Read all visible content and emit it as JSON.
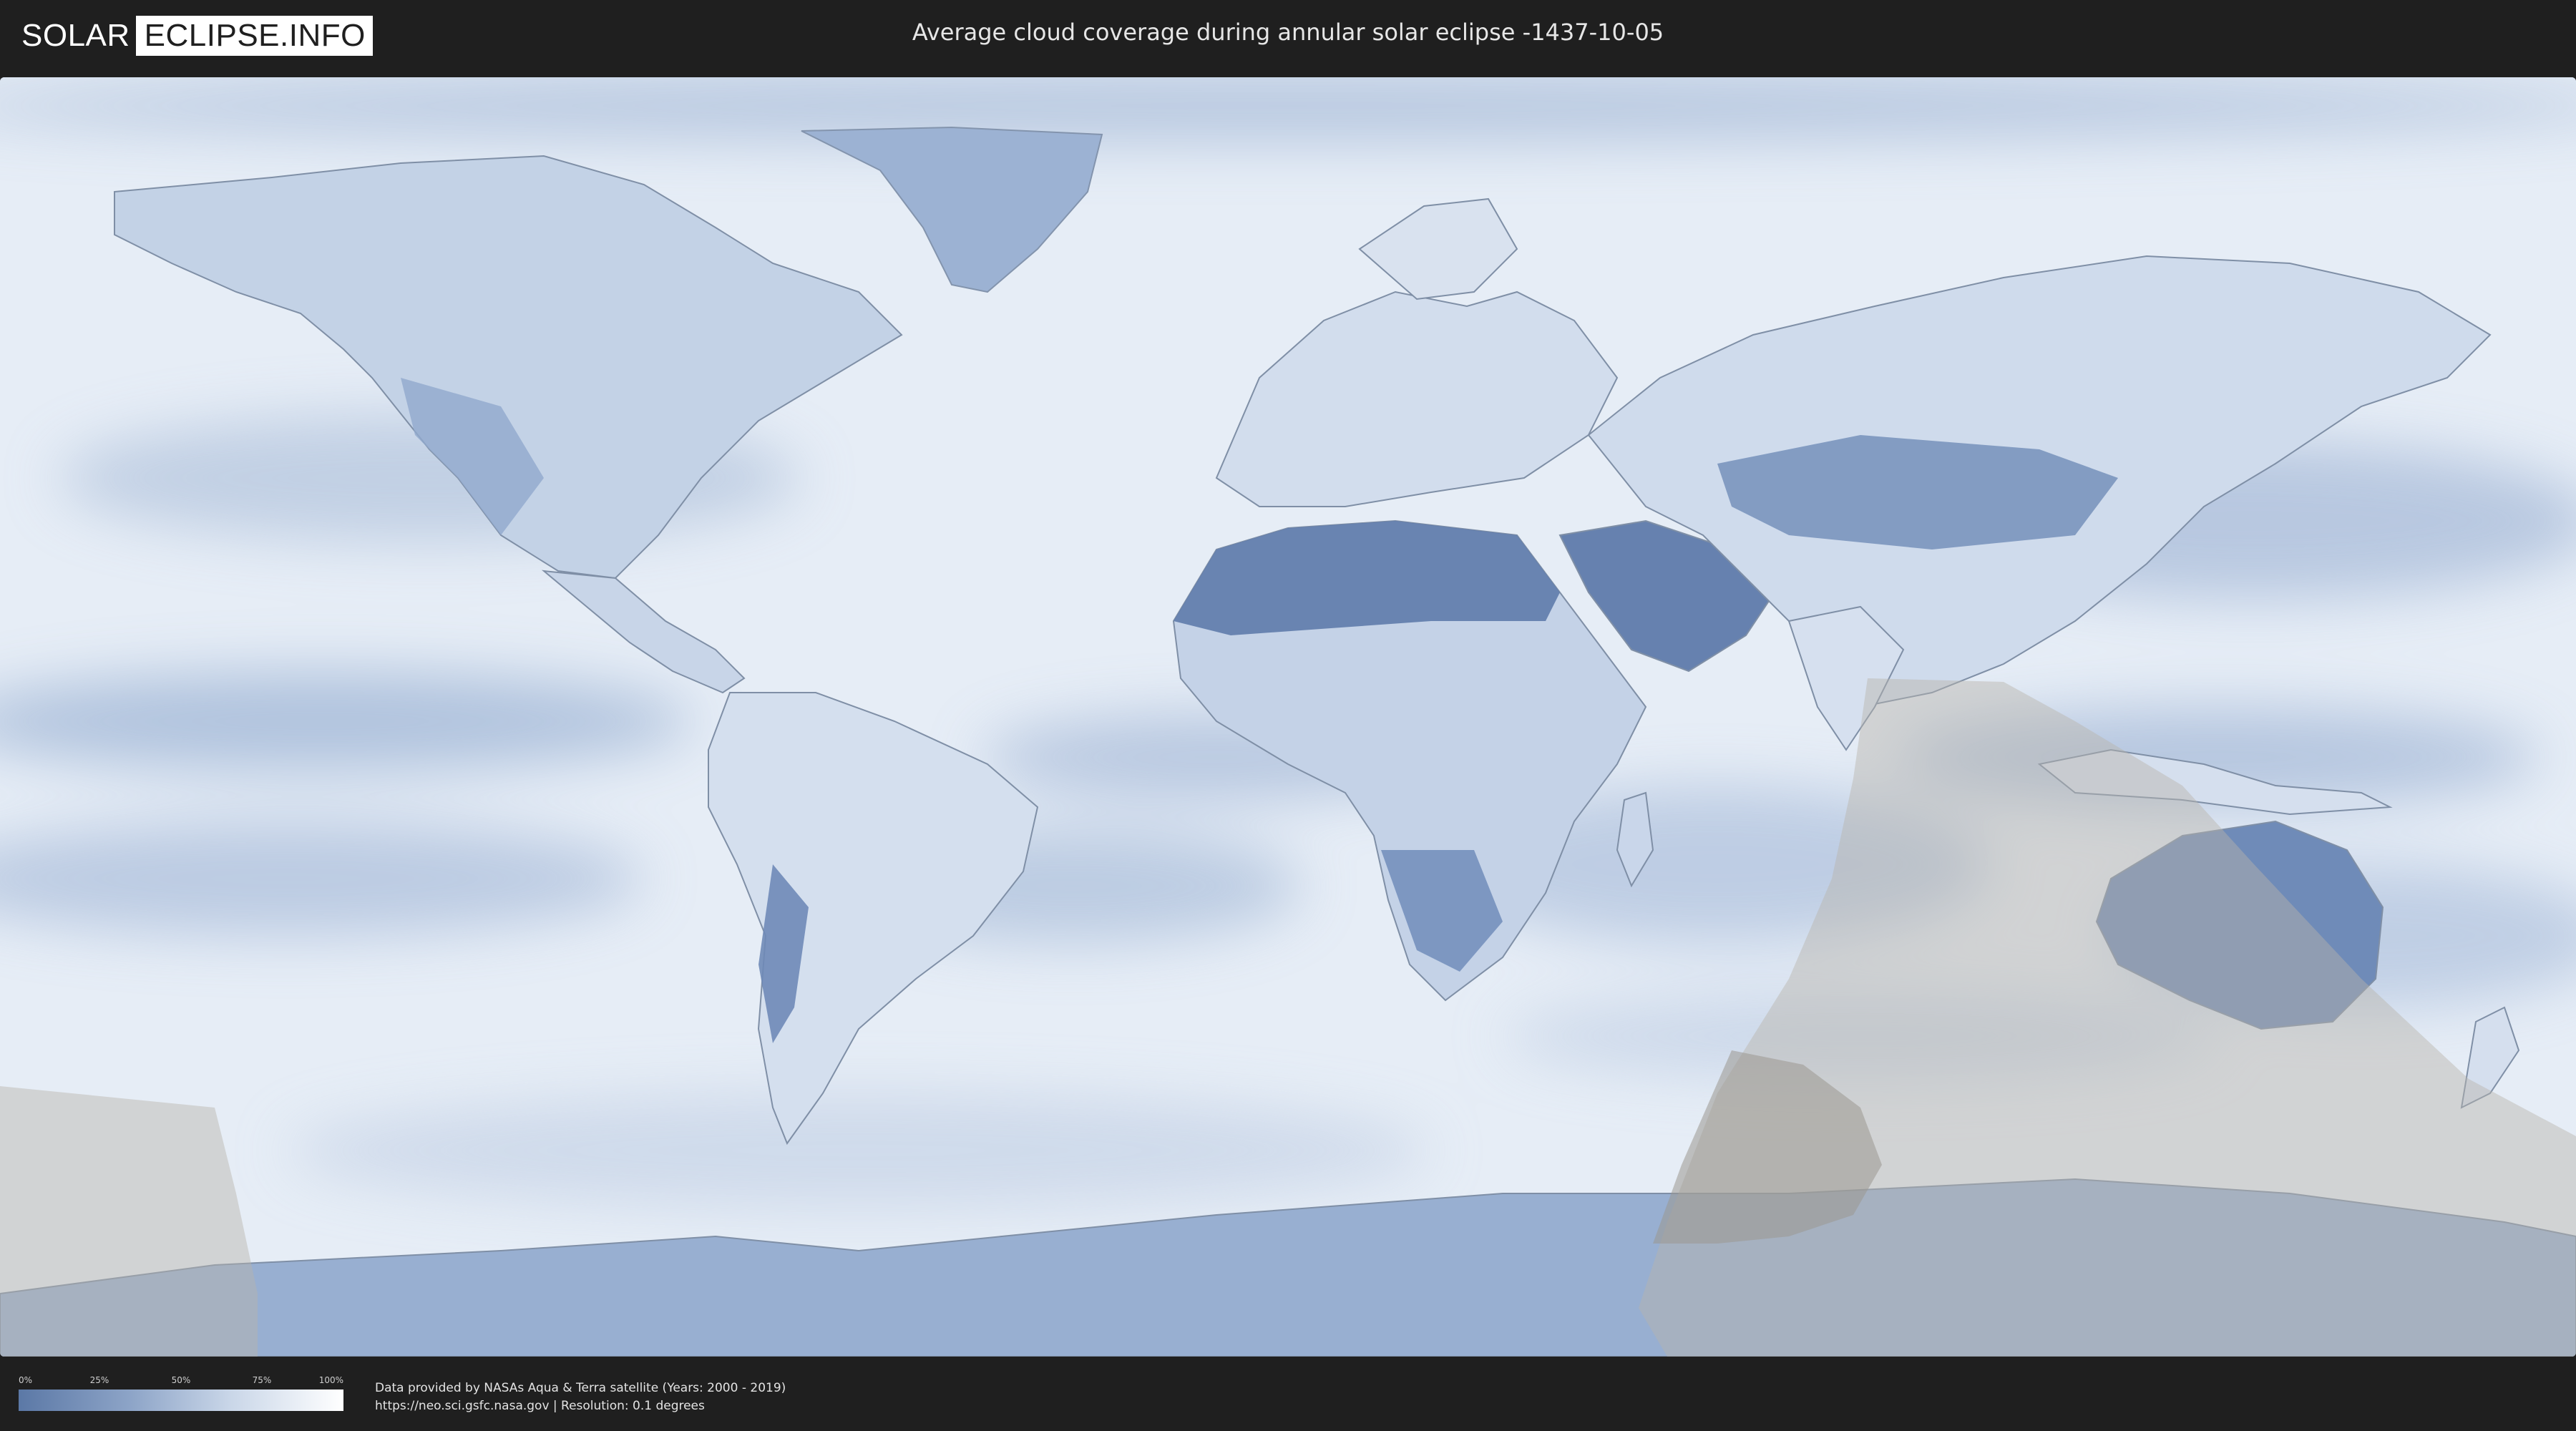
{
  "header": {
    "logo": {
      "part1": "SOLAR",
      "part2": "ECLIPSE.INFO"
    },
    "title": "Average cloud coverage during annular solar eclipse -1437-10-05"
  },
  "map": {
    "palette": {
      "ocean_light": "#eef3f9",
      "cloud_blue": "#8fa9cd",
      "dry_dark": "#6a86b3",
      "land_outline": "#7f8fa6",
      "eclipse_overlay": "#b9b4ab"
    }
  },
  "legend": {
    "ticks": [
      "0%",
      "25%",
      "50%",
      "75%",
      "100%"
    ],
    "gradient": [
      "#5b78a6",
      "#ffffff"
    ]
  },
  "credits": {
    "line1": "Data provided by NASAs Aqua & Terra satellite (Years: 2000 - 2019)",
    "line2": "https://neo.sci.gsfc.nasa.gov | Resolution: 0.1 degrees"
  }
}
